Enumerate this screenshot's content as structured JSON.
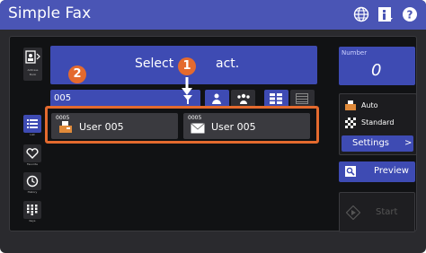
{
  "header": {
    "title": "Simple Fax"
  },
  "sidebar": {
    "address_book": {
      "line1": "Address",
      "line2": "Book"
    },
    "items": [
      {
        "label": "List",
        "icon": "list-icon"
      },
      {
        "label": "Favorite",
        "icon": "heart-icon"
      },
      {
        "label": "History",
        "icon": "clock-icon"
      },
      {
        "label": "Keys",
        "icon": "keypad-icon"
      }
    ]
  },
  "contact": {
    "label_left": "Select",
    "label_right": "act.",
    "full_label": "Select Contact."
  },
  "search": {
    "value": "005"
  },
  "entries": [
    {
      "number": "0005",
      "name": "User 005",
      "icon": "fax-machine-icon"
    },
    {
      "number": "0005",
      "name": "User 005",
      "icon": "envelope-icon"
    }
  ],
  "callouts": [
    "1",
    "2"
  ],
  "number_panel": {
    "label": "Number",
    "value": "0"
  },
  "settings_panel": {
    "resolution": "Auto",
    "mode": "Standard",
    "settings_label": "Settings",
    "settings_chevron": ">"
  },
  "actions": {
    "preview": "Preview",
    "start": "Start"
  },
  "colors": {
    "accent": "#3e4bb3",
    "title_bar": "#4a55b5",
    "callout": "#e46a2e"
  }
}
